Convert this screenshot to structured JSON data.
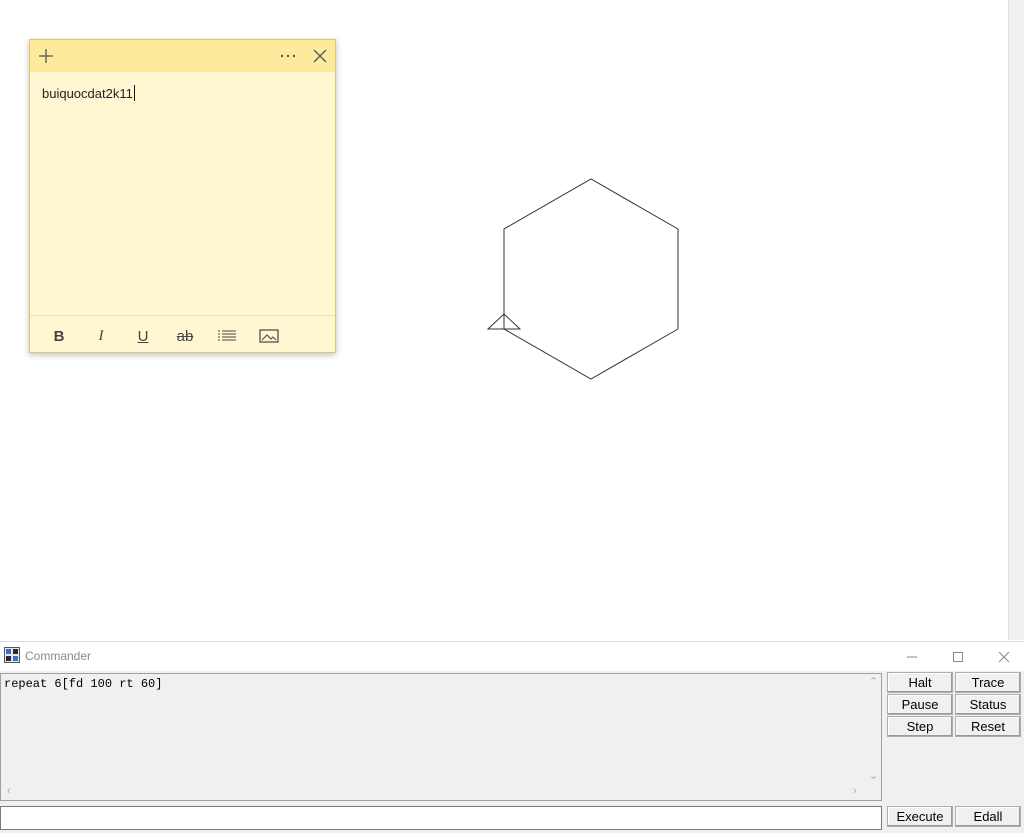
{
  "sticky_note": {
    "text": "buiquocdat2k11",
    "add_icon": "plus-icon",
    "more_icon": "ellipsis-icon",
    "close_icon": "close-icon",
    "toolbar": [
      "bold-icon",
      "italic-icon",
      "underline-icon",
      "strikethrough-icon",
      "bullet-list-icon",
      "image-icon"
    ]
  },
  "canvas": {
    "shape": "hexagon",
    "turtle_icon": "turtle-triangle-icon"
  },
  "commander": {
    "title": "Commander",
    "history": "repeat 6[fd 100 rt 60]",
    "input_value": "",
    "buttons": {
      "halt": "Halt",
      "trace": "Trace",
      "pause": "Pause",
      "status": "Status",
      "step": "Step",
      "reset": "Reset",
      "execute": "Execute",
      "edall": "Edall"
    }
  }
}
